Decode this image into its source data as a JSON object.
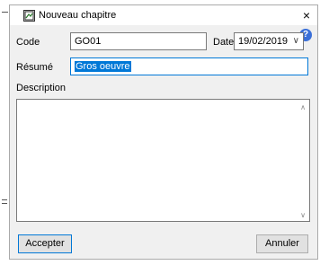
{
  "window": {
    "title": "Nouveau chapitre",
    "close_glyph": "×",
    "app_icon": "chapter-window-icon",
    "help_glyph": "?"
  },
  "form": {
    "code_label": "Code",
    "code_value": "GO01",
    "date_label": "Date",
    "date_value": "19/02/2019",
    "date_arrow": "∨",
    "resume_label": "Résumé",
    "resume_value": "Gros oeuvre",
    "description_label": "Description",
    "description_value": ""
  },
  "scrollbar": {
    "up": "∧",
    "down": "∨"
  },
  "buttons": {
    "accept": "Accepter",
    "cancel": "Annuler"
  },
  "colors": {
    "accent": "#0078d7",
    "help": "#3a6fd8",
    "dialog_bg": "#f0f0f0"
  }
}
